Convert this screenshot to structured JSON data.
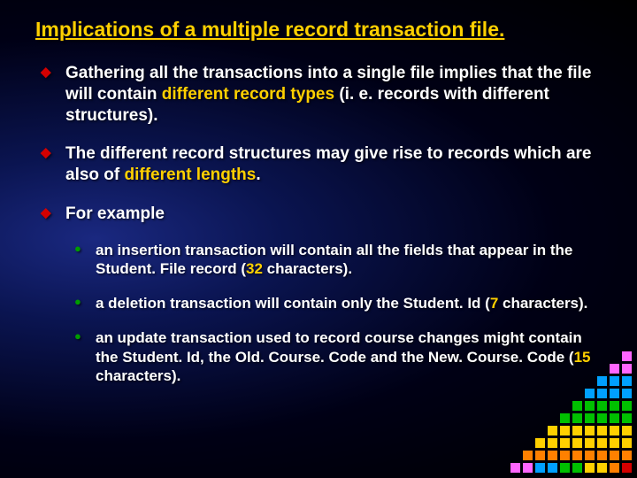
{
  "title": "Implications of a multiple record transaction file.",
  "b1a": "Gathering all the transactions into a single file implies that the file will contain ",
  "b1hl": "different record types",
  "b1b": " (i. e. records with different structures).",
  "b2a": "The different record structures may give rise to records which are also of ",
  "b2hl": "different lengths",
  "b2b": ".",
  "b3": "For example",
  "s1a": "an insertion transaction will contain all the fields that appear in the Student. File record  (",
  "s1hl": "32",
  "s1b": " characters).",
  "s2a": "a deletion transaction will contain only the Student. Id (",
  "s2hl": "7",
  "s2b": " characters).",
  "s3a": "an update transaction used to record course changes might contain the Student. Id, the Old. Course. Code and the New. Course. Code (",
  "s3hl": "15",
  "s3b": " characters).",
  "decor_colors": [
    "#ff66ff",
    "#ff66ff",
    "#00a0ff",
    "#00a0ff",
    "#00c000",
    "#00c000",
    "#ffd000",
    "#ffd000",
    "#ff8000",
    "#d40000"
  ]
}
